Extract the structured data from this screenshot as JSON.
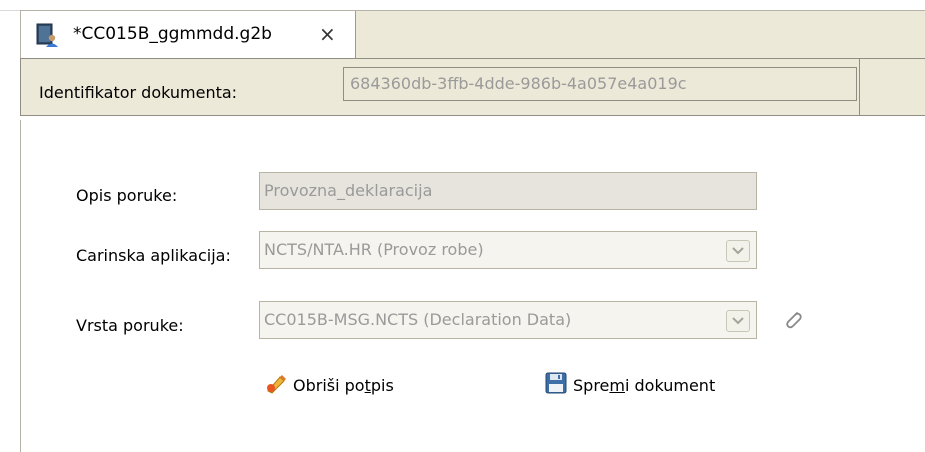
{
  "tab": {
    "title": "*CC015B_ggmmdd.g2b",
    "close_glyph": "×",
    "icon": "document-with-person-icon"
  },
  "id_bar": {
    "label": "Identifikator dokumenta:",
    "value": "684360db-3ffb-4dde-986b-4a057e4a019c"
  },
  "form": {
    "opis": {
      "label": "Opis poruke:",
      "value": "Provozna_deklaracija"
    },
    "carinska": {
      "label": "Carinska aplikacija:",
      "value": "NCTS/NTA.HR (Provoz robe)"
    },
    "vrsta": {
      "label": "Vrsta poruke:",
      "value": "CC015B-MSG.NCTS (Declaration Data)",
      "attach_icon": "paperclip-icon"
    }
  },
  "actions": {
    "delete_signature": {
      "pre": "Obriši po",
      "ul": "t",
      "post": "pis",
      "icon": "pen-sign-icon"
    },
    "save_document": {
      "pre": "Spre",
      "ul": "m",
      "post": "i dokument",
      "icon": "floppy-disk-icon"
    }
  },
  "colors": {
    "chrome": "#ece9d8",
    "disabled_text": "#9a9a9a",
    "field_border": "#b7b4a4"
  }
}
